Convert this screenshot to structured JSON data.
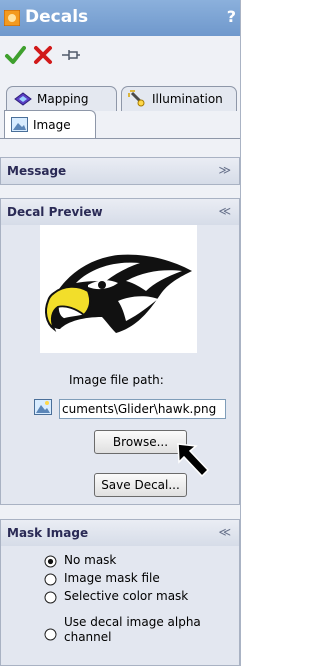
{
  "title": "Decals",
  "help": "?",
  "commands": {
    "ok": "ok",
    "cancel": "cancel",
    "pin": "pin"
  },
  "tabs": {
    "mapping": "Mapping",
    "illumination": "Illumination",
    "image": "Image"
  },
  "groups": {
    "message": {
      "title": "Message",
      "chevron": "≫"
    },
    "decal_preview": {
      "title": "Decal Preview",
      "chevron": "≪"
    },
    "mask_image": {
      "title": "Mask Image",
      "chevron": "≪"
    }
  },
  "image_file_path_label": "Image file path:",
  "image_file_path_value": "cuments\\Glider\\hawk.png",
  "buttons": {
    "browse": "Browse...",
    "save_decal": "Save Decal..."
  },
  "mask_options": [
    {
      "label": "No mask",
      "selected": true
    },
    {
      "label": "Image mask file",
      "selected": false
    },
    {
      "label": "Selective color mask",
      "selected": false
    },
    {
      "label": "Use decal image alpha\nchannel",
      "selected": false
    }
  ],
  "colors": {
    "title_bar": "#7aa1d2",
    "panel": "#eff1f6",
    "accent_ok": "#3fa02e",
    "accent_cancel": "#d11a1a"
  }
}
